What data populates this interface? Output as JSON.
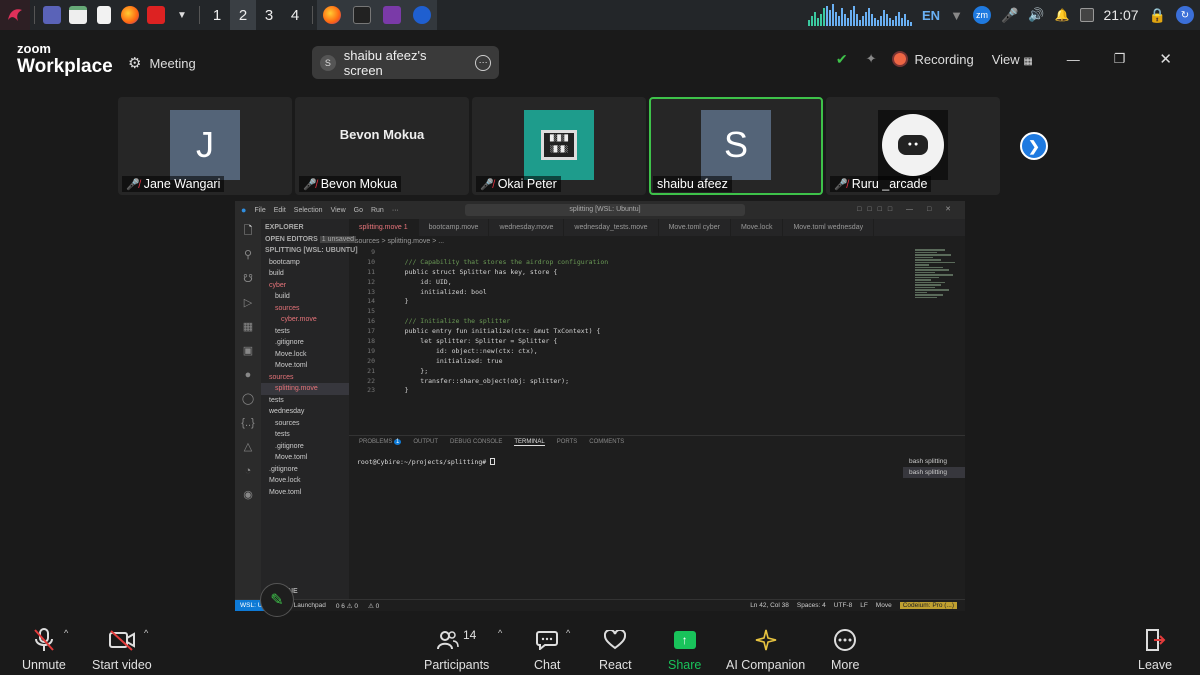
{
  "taskbar": {
    "desktops": [
      "1",
      "2",
      "3",
      "4"
    ],
    "language": "EN",
    "zoom_tray": "zm",
    "clock": "21:07"
  },
  "header": {
    "logo_line1": "zoom",
    "logo_line2": "Workplace",
    "meeting_label": "Meeting",
    "screen_share_label": "shaibu afeez's screen",
    "screen_share_initial": "S",
    "recording_label": "Recording",
    "view_label": "View"
  },
  "participants": [
    {
      "name": "Jane Wangari",
      "initial": "J",
      "muted": true
    },
    {
      "name": "Bevon Mokua",
      "card_text": "Bevon Mokua",
      "muted": true
    },
    {
      "name": "Okai Peter",
      "muted": true
    },
    {
      "name": "shaibu afeez",
      "initial": "S",
      "muted": false,
      "active": true
    },
    {
      "name": "Ruru _arcade",
      "muted": true
    }
  ],
  "shared_screen": {
    "menu": [
      "File",
      "Edit",
      "Selection",
      "View",
      "Go",
      "Run",
      "···"
    ],
    "command_center": "splitting [WSL: Ubuntu]",
    "explorer_title": "EXPLORER",
    "open_editors": "OPEN EDITORS",
    "open_editors_badge": "1 unsaved",
    "workspace": "SPLITTING [WSL: UBUNTU]",
    "tree": [
      "bootcamp",
      "build",
      "cyber",
      "build",
      "sources",
      "cyber.move",
      "tests",
      ".gitignore",
      "Move.lock",
      "Move.toml",
      "sources",
      "splitting.move",
      "tests",
      "wednesday",
      "sources",
      "tests",
      ".gitignore",
      "Move.toml",
      ".gitignore",
      "Move.lock",
      "Move.toml"
    ],
    "timeline": "TIMELINE",
    "tabs": [
      "splitting.move 1",
      "bootcamp.move",
      "wednesday.move",
      "wednesday_tests.move",
      "Move.toml cyber",
      "Move.lock",
      "Move.toml wednesday"
    ],
    "breadcrumb": "sources > splitting.move > ...",
    "lines": [
      {
        "n": "9",
        "code": ""
      },
      {
        "n": "10",
        "code": "    /// Capability that stores the airdrop configuration"
      },
      {
        "n": "11",
        "code": "    public struct Splitter has key, store {"
      },
      {
        "n": "12",
        "code": "        id: UID,"
      },
      {
        "n": "13",
        "code": "        initialized: bool"
      },
      {
        "n": "14",
        "code": "    }"
      },
      {
        "n": "15",
        "code": ""
      },
      {
        "n": "16",
        "code": "    /// Initialize the splitter"
      },
      {
        "n": "17",
        "code": "    public entry fun initialize(ctx: &mut TxContext) {"
      },
      {
        "n": "18",
        "code": "        let splitter: Splitter = Splitter {"
      },
      {
        "n": "19",
        "code": "            id: object::new(ctx: ctx),"
      },
      {
        "n": "20",
        "code": "            initialized: true"
      },
      {
        "n": "21",
        "code": "        };"
      },
      {
        "n": "22",
        "code": "        transfer::share_object(obj: splitter);"
      },
      {
        "n": "23",
        "code": "    }"
      }
    ],
    "panel_tabs": [
      "PROBLEMS",
      "OUTPUT",
      "DEBUG CONSOLE",
      "TERMINAL",
      "PORTS",
      "COMMENTS"
    ],
    "problems_count": "1",
    "terminal_prompt": "root@Cybire:~/projects/splitting# ",
    "terminals": [
      "bash splitting",
      "bash splitting"
    ],
    "status_remote": "WSL: Ubuntu",
    "status_left": [
      "Launchpad",
      "0 6 ⚠ 0",
      "⚠ 0"
    ],
    "status_right": [
      "Ln 42, Col 38",
      "Spaces: 4",
      "UTF-8",
      "LF",
      "Move"
    ],
    "status_pro": "Codeium: Pro (...)"
  },
  "toolbar": {
    "unmute": "Unmute",
    "start_video": "Start video",
    "participants": "Participants",
    "participants_count": "14",
    "chat": "Chat",
    "react": "React",
    "share": "Share",
    "ai_companion": "AI Companion",
    "more": "More",
    "leave": "Leave"
  },
  "colors": {
    "share_green": "#19c35b",
    "active_border": "#3ec24a",
    "muted_red": "#e33b3b",
    "accent_blue": "#1f7ae0"
  }
}
